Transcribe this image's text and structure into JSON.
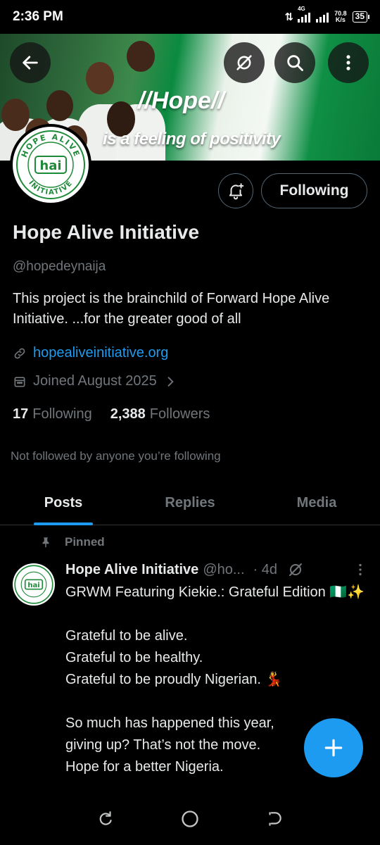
{
  "status_bar": {
    "time": "2:36 PM",
    "network_type": "4G",
    "net_speed_value": "70.8",
    "net_speed_unit": "K/s",
    "battery": "35"
  },
  "banner": {
    "headline": "//Hope//",
    "subline": "is a feeling of positivity"
  },
  "header_buttons": {
    "back_icon": "arrow-left-icon",
    "grok_icon": "grok-slash-circle-icon",
    "search_icon": "search-icon",
    "more_icon": "more-vertical-icon"
  },
  "avatar": {
    "logo_top": "HOPE ALIVE",
    "logo_mark": "hai",
    "logo_bottom": "INITIATIVE"
  },
  "profile": {
    "bell_icon": "bell-plus-icon",
    "follow_state": "Following",
    "display_name": "Hope Alive Initiative",
    "handle": "@hopedeynaija",
    "bio": "This project is the brainchild of Forward Hope Alive Initiative. ...for the greater good of all",
    "website": "hopealiveinitiative.org",
    "joined": "Joined August 2025",
    "following_count": "17",
    "following_label": "Following",
    "followers_count": "2,388",
    "followers_label": "Followers",
    "not_followed_text": "Not followed by anyone you’re following"
  },
  "tabs": [
    {
      "label": "Posts",
      "active": true
    },
    {
      "label": "Replies",
      "active": false
    },
    {
      "label": "Media",
      "active": false
    }
  ],
  "post": {
    "pinned_label": "Pinned",
    "author_name": "Hope Alive Initiative",
    "author_handle": "@ho...",
    "time": "· 4d",
    "lines": [
      "GRWM Featuring Kiekie.: Grateful Edition 🇳🇬✨",
      "",
      "Grateful to be alive.",
      "Grateful to be healthy.",
      "Grateful to be proudly Nigerian. 💃",
      "",
      "So much has happened this year,",
      "giving up? That’s not the move.",
      "Hope for a better Nigeria."
    ]
  },
  "fab": {
    "icon": "plus-icon"
  },
  "nav_bar": {
    "recents_icon": "recents-icon",
    "home_icon": "home-circle-icon",
    "back_icon": "back-nav-icon"
  },
  "colors": {
    "accent": "#1d9bf0",
    "text_primary": "#e7e9ea",
    "text_secondary": "#71767b",
    "border": "#2f3336",
    "logo_green": "#1f8a3a"
  }
}
